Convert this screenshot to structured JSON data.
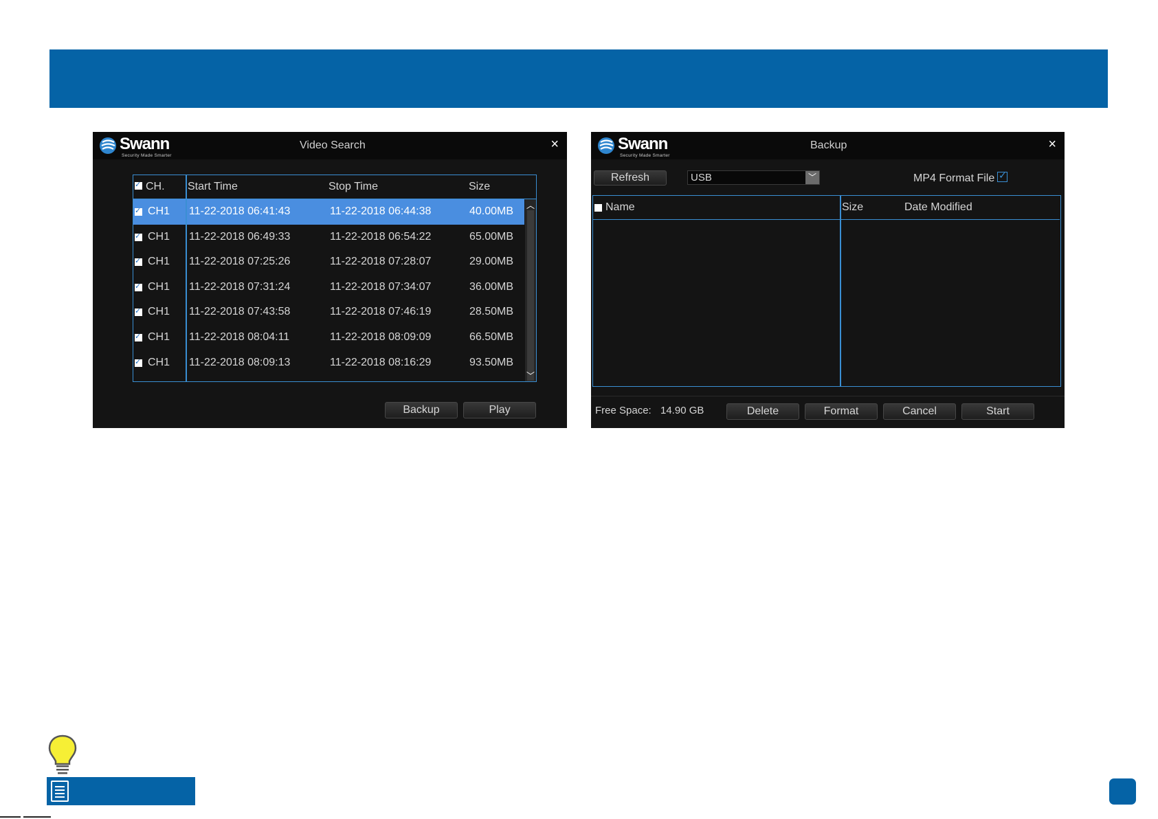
{
  "video_search": {
    "logo": {
      "word": "Swann",
      "tagline": "Security Made Smarter"
    },
    "title": "Video Search",
    "close": "×",
    "columns": {
      "ch": "CH.",
      "start": "Start Time",
      "stop": "Stop Time",
      "size": "Size"
    },
    "header_checked": true,
    "rows": [
      {
        "checked": true,
        "ch": "CH1",
        "start": "11-22-2018 06:41:43",
        "stop": "11-22-2018 06:44:38",
        "size": "40.00MB",
        "selected": true
      },
      {
        "checked": true,
        "ch": "CH1",
        "start": "11-22-2018 06:49:33",
        "stop": "11-22-2018 06:54:22",
        "size": "65.00MB"
      },
      {
        "checked": true,
        "ch": "CH1",
        "start": "11-22-2018 07:25:26",
        "stop": "11-22-2018 07:28:07",
        "size": "29.00MB"
      },
      {
        "checked": true,
        "ch": "CH1",
        "start": "11-22-2018 07:31:24",
        "stop": "11-22-2018 07:34:07",
        "size": "36.00MB"
      },
      {
        "checked": true,
        "ch": "CH1",
        "start": "11-22-2018 07:43:58",
        "stop": "11-22-2018 07:46:19",
        "size": "28.50MB"
      },
      {
        "checked": true,
        "ch": "CH1",
        "start": "11-22-2018 08:04:11",
        "stop": "11-22-2018 08:09:09",
        "size": "66.50MB"
      },
      {
        "checked": true,
        "ch": "CH1",
        "start": "11-22-2018 08:09:13",
        "stop": "11-22-2018 08:16:29",
        "size": "93.50MB"
      }
    ],
    "buttons": {
      "backup": "Backup",
      "play": "Play"
    }
  },
  "backup": {
    "logo": {
      "word": "Swann",
      "tagline": "Security Made Smarter"
    },
    "title": "Backup",
    "close": "×",
    "refresh_label": "Refresh",
    "device_select": "USB",
    "mp4_label": "MP4 Format File",
    "mp4_checked": true,
    "columns": {
      "name": "Name",
      "size": "Size",
      "date": "Date Modified"
    },
    "free_space_label": "Free Space:",
    "free_space_value": "14.90 GB",
    "buttons": {
      "delete": "Delete",
      "format": "Format",
      "cancel": "Cancel",
      "start": "Start"
    }
  },
  "colors": {
    "brand_blue": "#0563a6",
    "accent_blue": "#3a8fd4",
    "selected_row": "#4a8ee0",
    "bulb_yellow": "#f6ef35"
  },
  "icons": {
    "logo": "swann-logo-icon",
    "tip": "lightbulb-icon",
    "note": "document-icon"
  }
}
